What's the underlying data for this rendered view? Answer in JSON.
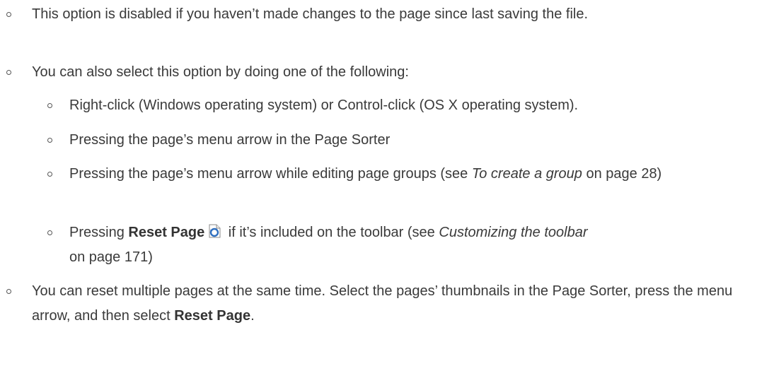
{
  "bullets": {
    "disabled_note": "This option is disabled if you haven’t made changes to the page since last saving the file.",
    "also_select_intro": "You can also select this option by doing one of the following:",
    "sub": {
      "right_click": "Right-click (Windows operating system) or Control-click (OS X operating system).",
      "page_sorter": "Pressing the page’s menu arrow in the Page Sorter",
      "groups_pre": "Pressing the page’s menu arrow while editing page groups (see ",
      "groups_link": "To create a group",
      "groups_post": " on page 28)",
      "reset_pre": "Pressing ",
      "reset_bold": "Reset Page",
      "reset_mid": " if it’s included on the toolbar (see ",
      "reset_link": "Customizing the toolbar",
      "reset_post": " on page 171)"
    },
    "multiple_pre": "You can reset multiple pages at the same time. Select the pages’ thumbnails in the Page Sorter, press the menu arrow, and then select ",
    "multiple_bold": "Reset Page",
    "multiple_post": "."
  },
  "icons": {
    "reset_page": "reset-page-icon",
    "bullet": "hollow-circle-bullet"
  },
  "colors": {
    "text": "#3a3a3a",
    "icon_blue": "#2f6fbf"
  }
}
